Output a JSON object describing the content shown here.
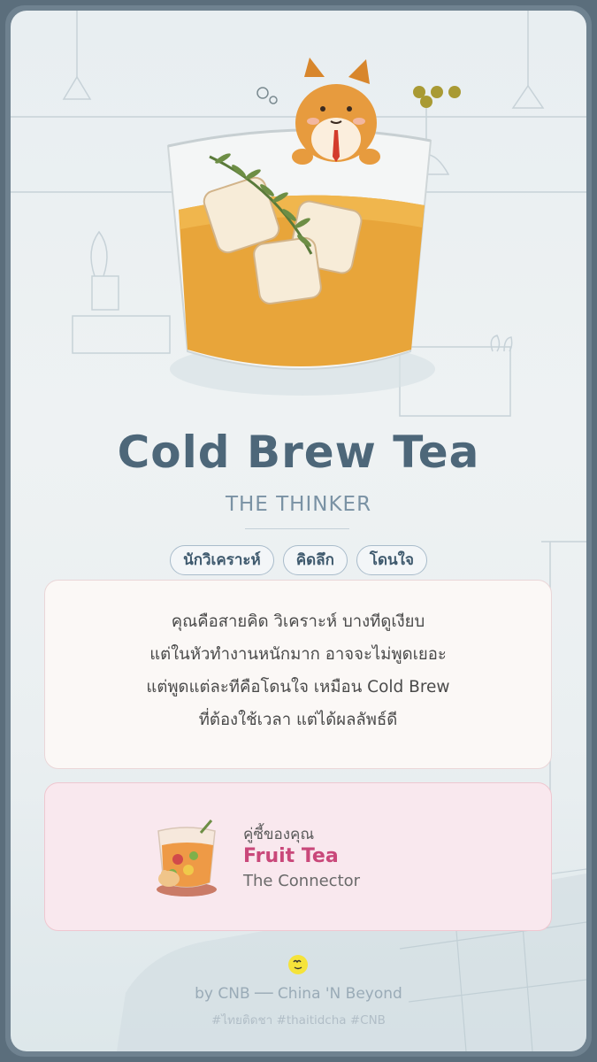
{
  "drink": {
    "name": "Cold Brew Tea",
    "persona": "THE THINKER"
  },
  "tags": [
    "นักวิเคราะห์",
    "คิดลึก",
    "โดนใจ"
  ],
  "description": {
    "lines": [
      "คุณคือสายคิด วิเคราะห์ บางทีดูเงียบ",
      "แต่ในหัวทำงานหนักมาก อาจจะไม่พูดเยอะ",
      "แต่พูดแต่ละทีคือโดนใจ เหมือน Cold Brew",
      "ที่ต้องใช้เวลา แต่ได้ผลลัพธ์ดี"
    ]
  },
  "pair": {
    "label": "คู่ซี้ของคุณ",
    "name": "Fruit Tea",
    "role": "The Connector",
    "image_icon": "fruit-tea-illustration"
  },
  "footer": {
    "credit": "by CNB ── China 'N Beyond",
    "hashtags": "#ไทยติดชา #thaitidcha #CNB",
    "logo_icon": "cnb-smiley-logo"
  },
  "colors": {
    "title": "#4d6779",
    "subtitle": "#7a92a4",
    "pair_name": "#c9487a",
    "tea": "#e8a53a",
    "frame": "#6f8290"
  }
}
